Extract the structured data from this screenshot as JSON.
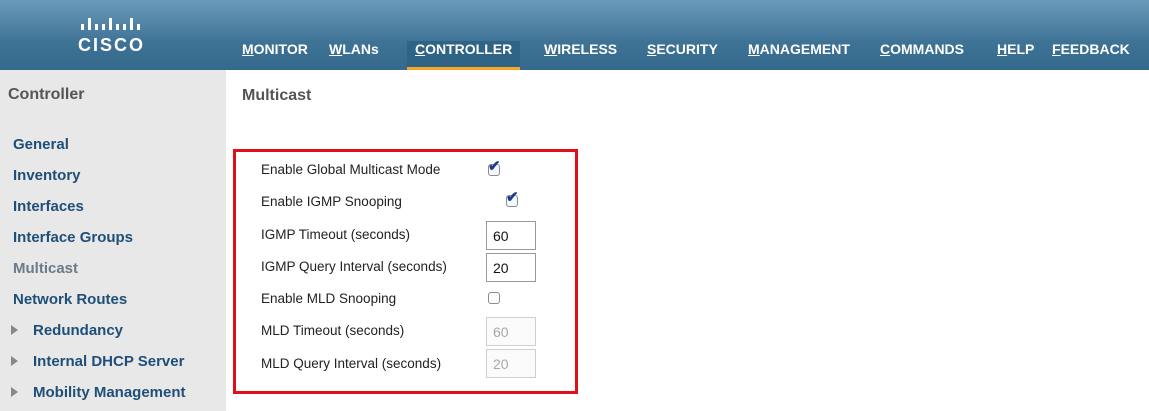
{
  "brand": {
    "logo_text": "CISCO"
  },
  "nav": {
    "monitor": "MONITOR",
    "wlans": "WLANs",
    "controller": "CONTROLLER",
    "wireless": "WIRELESS",
    "security": "SECURITY",
    "management": "MANAGEMENT",
    "commands": "COMMANDS",
    "help": "HELP",
    "feedback": "FEEDBACK",
    "active": "CONTROLLER"
  },
  "sidebar": {
    "title": "Controller",
    "items": [
      {
        "label": "General"
      },
      {
        "label": "Inventory"
      },
      {
        "label": "Interfaces"
      },
      {
        "label": "Interface Groups"
      },
      {
        "label": "Multicast",
        "current": true
      },
      {
        "label": "Network Routes"
      },
      {
        "label": "Redundancy",
        "expandable": true
      },
      {
        "label": "Internal DHCP Server",
        "expandable": true
      },
      {
        "label": "Mobility Management",
        "expandable": true
      }
    ]
  },
  "main": {
    "title": "Multicast",
    "settings": {
      "global_multicast": {
        "label": "Enable Global Multicast Mode",
        "checked": true
      },
      "igmp_snooping": {
        "label": "Enable IGMP Snooping",
        "checked": true
      },
      "igmp_timeout": {
        "label": "IGMP Timeout (seconds)",
        "value": "60"
      },
      "igmp_query_interval": {
        "label": "IGMP Query Interval (seconds)",
        "value": "20"
      },
      "mld_snooping": {
        "label": "Enable MLD Snooping",
        "checked": false
      },
      "mld_timeout": {
        "label": "MLD Timeout (seconds)",
        "value": "60",
        "disabled": true
      },
      "mld_query_interval": {
        "label": "MLD Query Interval (seconds)",
        "value": "20",
        "disabled": true
      }
    }
  },
  "colors": {
    "header": "#3f7396",
    "active_tab_underline": "#f5a623",
    "sidebar_link": "#1f4e79",
    "highlight_border": "#e0101a"
  }
}
